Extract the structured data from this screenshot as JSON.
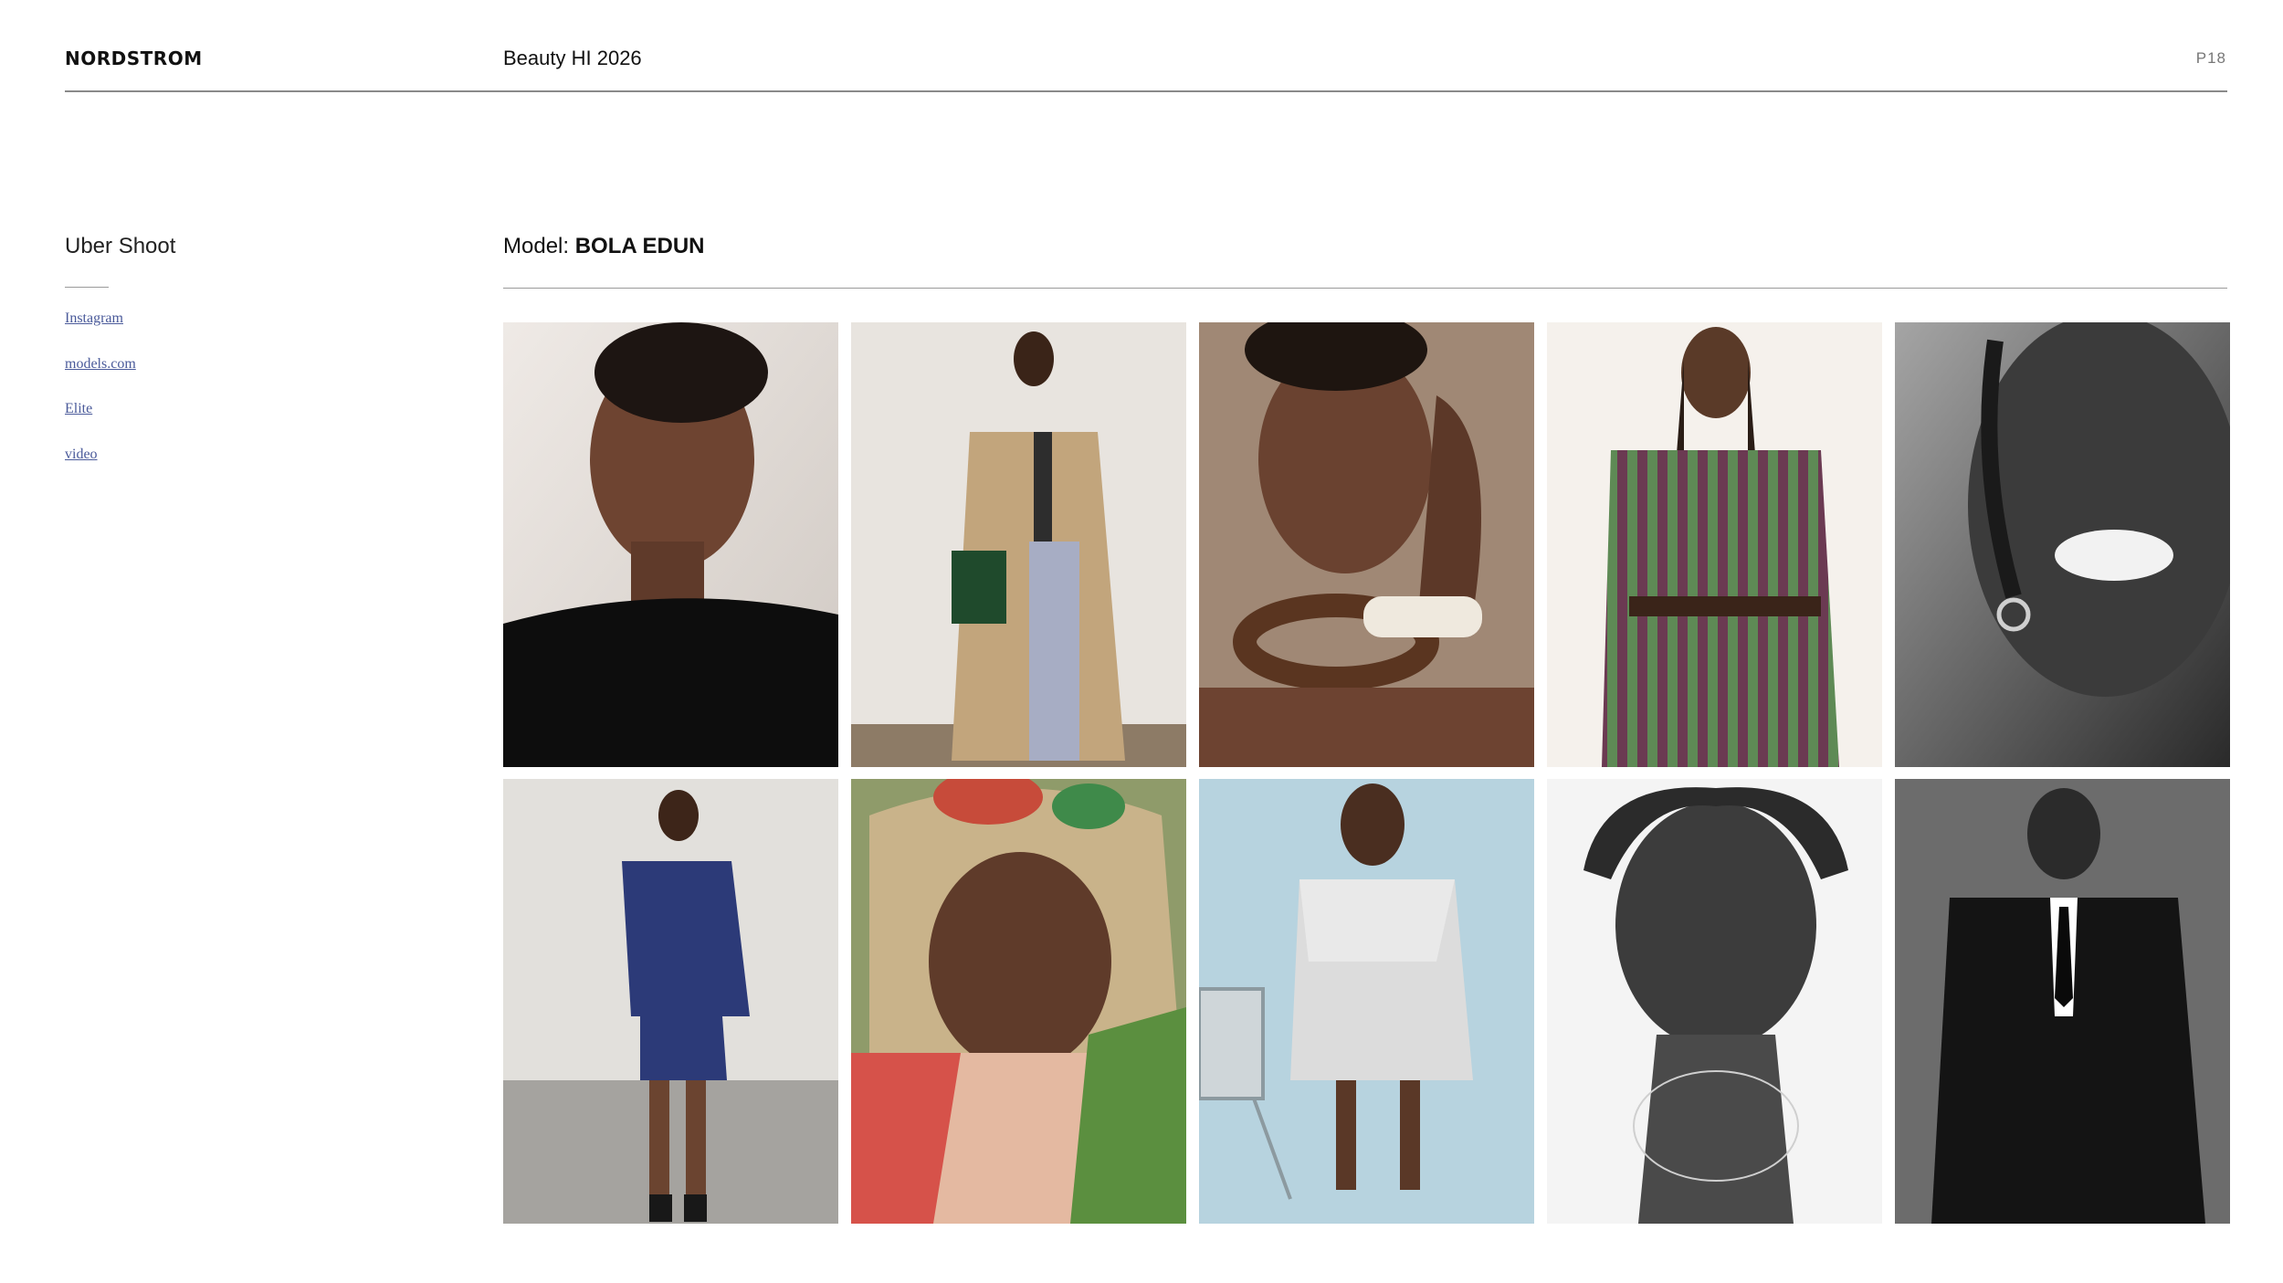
{
  "header": {
    "brand": "NORDSTROM",
    "title": "Beauty HI 2026",
    "page": "P18"
  },
  "sidebar": {
    "title": "Uber Shoot",
    "links": [
      {
        "label": "Instagram"
      },
      {
        "label": "models.com"
      },
      {
        "label": "Elite"
      },
      {
        "label": "video"
      }
    ]
  },
  "main": {
    "model_label": "Model:",
    "model_name": "BOLA EDUN"
  },
  "colors": {
    "rule": "#8a8a8a",
    "link": "#4a5a9a",
    "text": "#111111"
  }
}
